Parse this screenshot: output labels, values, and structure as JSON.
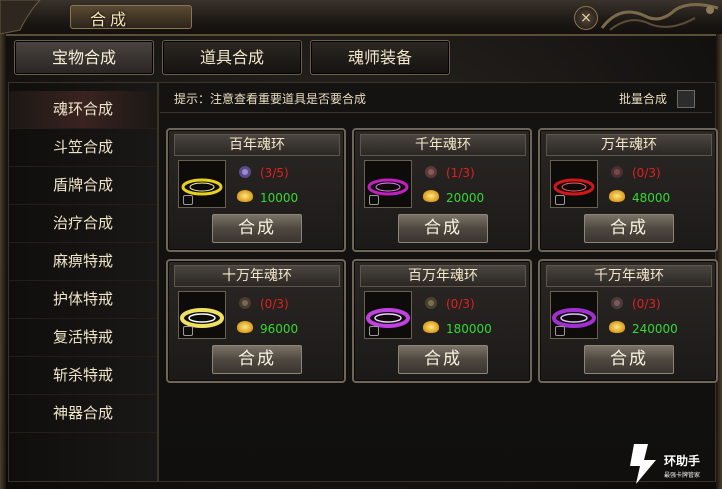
{
  "window": {
    "title": "合成",
    "close_label": "×"
  },
  "tabs": [
    {
      "label": "宝物合成",
      "active": true
    },
    {
      "label": "道具合成",
      "active": false
    },
    {
      "label": "魂师装备",
      "active": false
    }
  ],
  "sidebar": {
    "items": [
      {
        "label": "魂环合成",
        "active": true
      },
      {
        "label": "斗笠合成"
      },
      {
        "label": "盾牌合成"
      },
      {
        "label": "治疗合成"
      },
      {
        "label": "麻痹特戒"
      },
      {
        "label": "护体特戒"
      },
      {
        "label": "复活特戒"
      },
      {
        "label": "斩杀特戒"
      },
      {
        "label": "神器合成"
      }
    ]
  },
  "hint": "提示：注意查看重要道具是否要合成",
  "batch_label": "批量合成",
  "cards": [
    {
      "title": "百年魂环",
      "count": "(3/5)",
      "cost": "10000",
      "ring_color": "#e8d020",
      "button": "合成"
    },
    {
      "title": "千年魂环",
      "count": "(1/3)",
      "cost": "20000",
      "ring_color": "#c020c0",
      "button": "合成"
    },
    {
      "title": "万年魂环",
      "count": "(0/3)",
      "cost": "48000",
      "ring_color": "#d01818",
      "button": "合成"
    },
    {
      "title": "十万年魂环",
      "count": "(0/3)",
      "cost": "96000",
      "ring_color": "#f0e060",
      "button": "合成"
    },
    {
      "title": "百万年魂环",
      "count": "(0/3)",
      "cost": "180000",
      "ring_color": "#c040e0",
      "button": "合成"
    },
    {
      "title": "千万年魂环",
      "count": "(0/3)",
      "cost": "240000",
      "ring_color": "#a030d0",
      "button": "合成"
    }
  ],
  "watermark": {
    "main": "环助手",
    "sub": "最强卡牌管家"
  },
  "colors": {
    "count_red": "#e02020",
    "cost_green": "#35d935",
    "accent_gold": "#8a7451"
  }
}
